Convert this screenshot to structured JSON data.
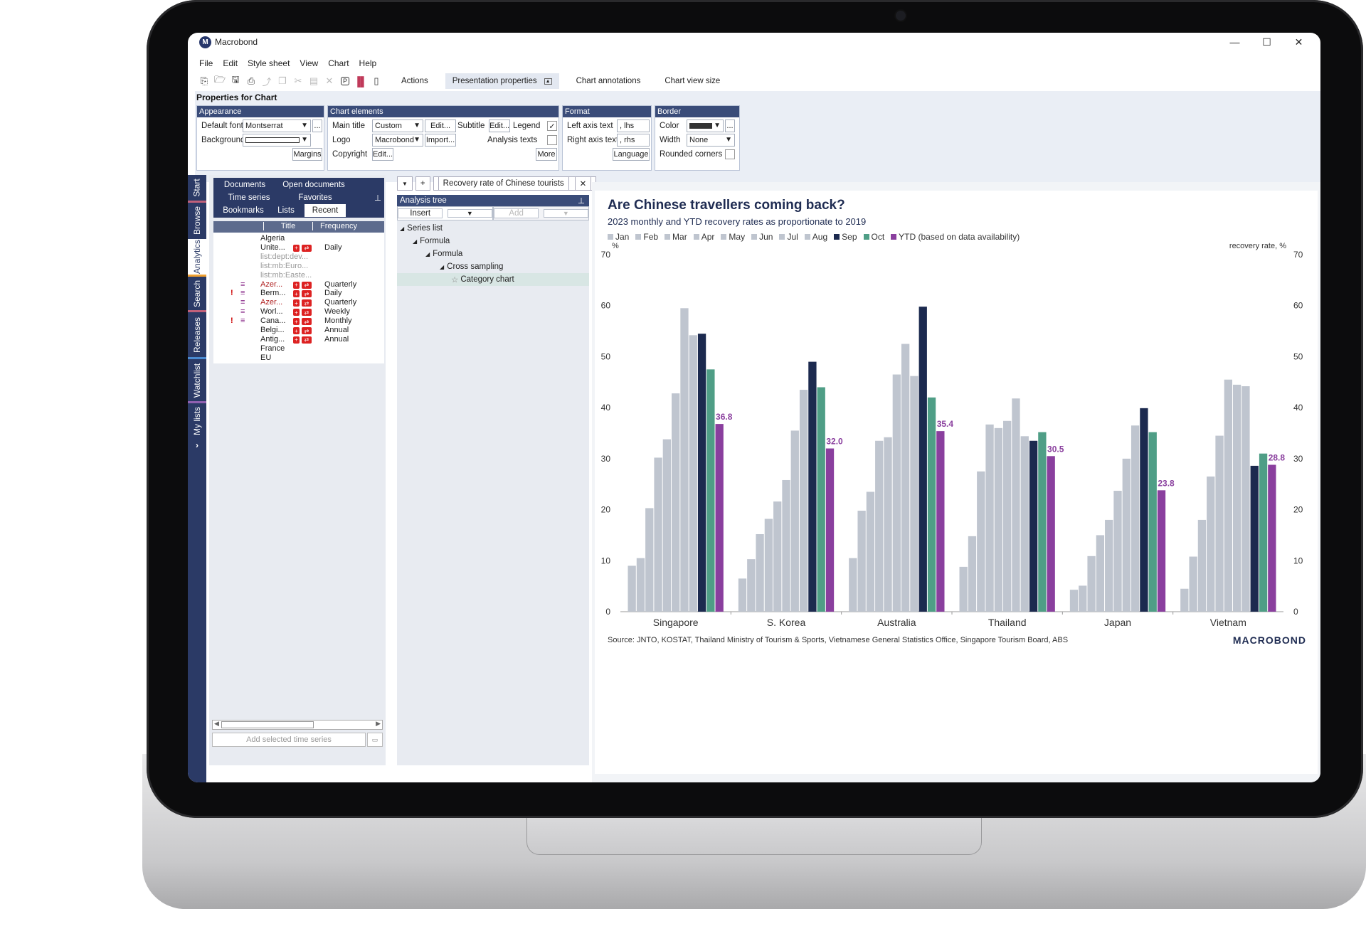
{
  "window": {
    "title": "Macrobond",
    "logo_letter": "M",
    "minimize": "—",
    "maximize": "☐",
    "close": "✕"
  },
  "menu": [
    "File",
    "Edit",
    "Style sheet",
    "View",
    "Chart",
    "Help"
  ],
  "toolbar": {
    "tabs": [
      "Actions",
      "Presentation properties",
      "Chart annotations",
      "Chart view size"
    ],
    "active_tab": "Presentation properties"
  },
  "properties": {
    "title": "Properties for Chart",
    "appearance": {
      "head": "Appearance",
      "default_font_label": "Default font",
      "default_font_value": "Montserrat",
      "background_label": "Background",
      "margins_button": "Margins",
      "more": "..."
    },
    "chart_elements": {
      "head": "Chart elements",
      "main_title_label": "Main title",
      "main_title_value": "Custom",
      "edit_button": "Edit...",
      "subtitle_label": "Subtitle",
      "subtitle_edit": "Edit...",
      "legend_label": "Legend",
      "legend_checked": "✓",
      "logo_label": "Logo",
      "logo_value": "Macrobond",
      "import_button": "Import...",
      "analysis_texts_label": "Analysis texts",
      "copyright_label": "Copyright",
      "copyright_edit": "Edit...",
      "more_button": "More"
    },
    "format": {
      "head": "Format",
      "left_axis_label": "Left axis text",
      "left_axis_value": ", lhs",
      "right_axis_label": "Right axis text",
      "right_axis_value": ", rhs",
      "language_button": "Language"
    },
    "border": {
      "head": "Border",
      "color_label": "Color",
      "width_label": "Width",
      "width_value": "None",
      "rounded_label": "Rounded corners",
      "more": "..."
    }
  },
  "vnav": [
    "Start",
    "Browse",
    "Analytics",
    "Search",
    "Releases",
    "Watchlist",
    "My lists",
    "›"
  ],
  "browse": {
    "tabs_row1": [
      "Documents",
      "Open documents"
    ],
    "tabs_row2": [
      "Time series",
      "Favorites"
    ],
    "tabs_row3": [
      "Bookmarks",
      "Lists",
      "Recent"
    ],
    "active_tab": "Recent",
    "col_title": "Title",
    "col_frequency": "Frequency",
    "rows": [
      {
        "title": "Algeria",
        "freq": "",
        "flag": "",
        "icon": ""
      },
      {
        "title": "Unite...",
        "freq": "Daily",
        "flag": "",
        "icon": ""
      },
      {
        "title": "list:dept:dev...",
        "freq": "",
        "flag": "",
        "icon": ""
      },
      {
        "title": "list:mb:Euro...",
        "freq": "",
        "flag": "",
        "icon": ""
      },
      {
        "title": "list:mb:Easte...",
        "freq": "",
        "flag": "",
        "icon": ""
      },
      {
        "title": "Azer...",
        "freq": "Quarterly",
        "flag": "",
        "icon": "≡"
      },
      {
        "title": "Berm...",
        "freq": "Daily",
        "flag": "!",
        "icon": "≡"
      },
      {
        "title": "Azer...",
        "freq": "Quarterly",
        "flag": "",
        "icon": "≡"
      },
      {
        "title": "Worl...",
        "freq": "Weekly",
        "flag": "",
        "icon": "≡"
      },
      {
        "title": "Cana...",
        "freq": "Monthly",
        "flag": "!",
        "icon": "≡"
      },
      {
        "title": "Belgi...",
        "freq": "Annual",
        "flag": "",
        "icon": ""
      },
      {
        "title": "Antig...",
        "freq": "Annual",
        "flag": "",
        "icon": ""
      },
      {
        "title": "France",
        "freq": "",
        "flag": "",
        "icon": ""
      },
      {
        "title": "EU",
        "freq": "",
        "flag": "",
        "icon": ""
      }
    ],
    "add_selected": "Add selected time series"
  },
  "document_tab": "Recovery rate of Chinese tourists",
  "analysis_tree": {
    "head": "Analysis tree",
    "insert": "Insert",
    "add": "Add",
    "nodes": [
      "Series list",
      "Formula",
      "Formula",
      "Cross sampling",
      "Category chart"
    ]
  },
  "chart_data": {
    "type": "bar",
    "title": "Are Chinese travellers coming back?",
    "subtitle": "2023 monthly and YTD recovery rates as proportionate to 2019",
    "ylabel_left": "%",
    "ylabel_right": "recovery rate, %",
    "ylim": [
      0,
      70
    ],
    "yticks": [
      0,
      10,
      20,
      30,
      40,
      50,
      60,
      70
    ],
    "categories": [
      "Singapore",
      "S. Korea",
      "Australia",
      "Thailand",
      "Japan",
      "Vietnam"
    ],
    "series": [
      {
        "name": "Jan",
        "color": "#bfc5cf",
        "values": [
          9,
          6.5,
          10.5,
          8.8,
          4.3,
          4.5
        ]
      },
      {
        "name": "Feb",
        "color": "#bfc5cf",
        "values": [
          10.5,
          10.3,
          19.8,
          14.8,
          5.1,
          10.8
        ]
      },
      {
        "name": "Mar",
        "color": "#bfc5cf",
        "values": [
          20.3,
          15.2,
          23.5,
          27.5,
          10.9,
          18
        ]
      },
      {
        "name": "Apr",
        "color": "#bfc5cf",
        "values": [
          30.2,
          18.2,
          33.5,
          36.7,
          15,
          26.5
        ]
      },
      {
        "name": "May",
        "color": "#bfc5cf",
        "values": [
          33.8,
          21.6,
          34.2,
          36,
          18,
          34.5
        ]
      },
      {
        "name": "Jun",
        "color": "#bfc5cf",
        "values": [
          42.8,
          25.8,
          46.5,
          37.4,
          23.7,
          45.5
        ]
      },
      {
        "name": "Jul",
        "color": "#bfc5cf",
        "values": [
          59.5,
          35.5,
          52.5,
          41.8,
          30,
          44.5
        ]
      },
      {
        "name": "Aug",
        "color": "#bfc5cf",
        "values": [
          54.2,
          43.5,
          46.2,
          34.4,
          36.5,
          44.2
        ]
      },
      {
        "name": "Sep",
        "color": "#1c2a4f",
        "values": [
          54.5,
          49,
          59.8,
          33.5,
          39.9,
          28.6
        ]
      },
      {
        "name": "Oct",
        "color": "#4f9e86",
        "values": [
          47.5,
          44,
          42,
          35.2,
          35.2,
          31
        ]
      },
      {
        "name": "YTD (based on data availability)",
        "color": "#8a3f9e",
        "values": [
          36.8,
          32.0,
          35.4,
          30.5,
          23.8,
          28.8
        ]
      }
    ],
    "ytd_labels": [
      "36.8",
      "32.0",
      "35.4",
      "30.5",
      "23.8",
      "28.8"
    ],
    "grid": false,
    "legend_position": "top-left",
    "source": "Source: JNTO, KOSTAT, Thailand Ministry of Tourism & Sports, Vietnamese General Statistics Office, Singapore Tourism Board, ABS",
    "brand": "MACROBOND"
  }
}
